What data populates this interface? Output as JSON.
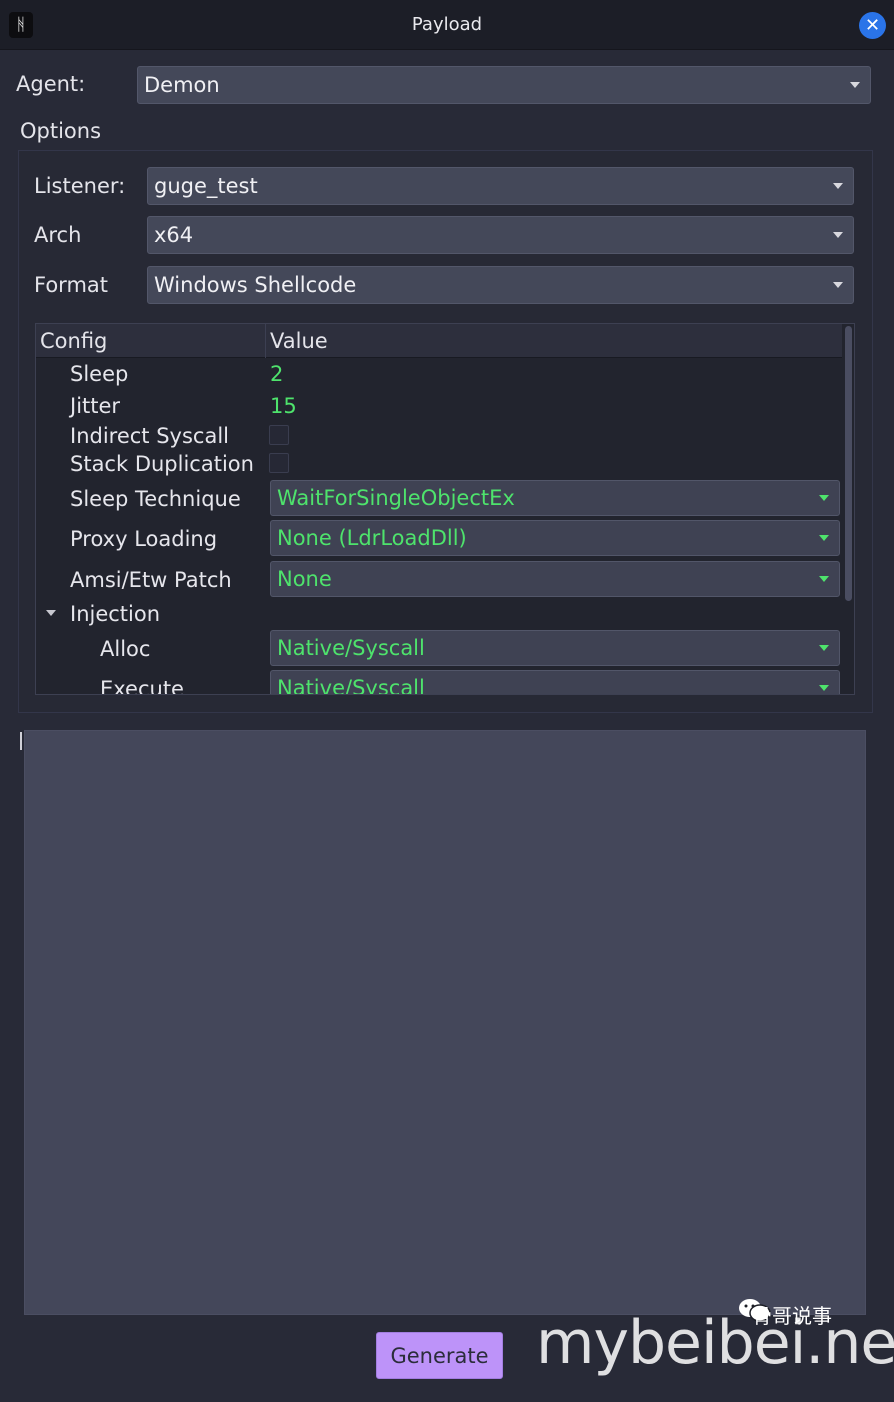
{
  "window": {
    "title": "Payload",
    "app_icon_glyph": "ᚻ",
    "close_glyph": "✕",
    "accent": "#2a74e8"
  },
  "agent": {
    "label": "Agent:",
    "value": "Demon"
  },
  "options": {
    "title": "Options",
    "listener": {
      "label": "Listener:",
      "value": "guge_test"
    },
    "arch": {
      "label": "Arch",
      "value": "x64"
    },
    "format": {
      "label": "Format",
      "value": "Windows Shellcode"
    }
  },
  "config_tree": {
    "headers": {
      "config": "Config",
      "value": "Value"
    },
    "rows": {
      "sleep": {
        "label": "Sleep",
        "value": "2"
      },
      "jitter": {
        "label": "Jitter",
        "value": "15"
      },
      "indirect_syscall": {
        "label": "Indirect Syscall",
        "checked": false
      },
      "stack_duplication": {
        "label": "Stack Duplication",
        "checked": false
      },
      "sleep_technique": {
        "label": "Sleep Technique",
        "value": "WaitForSingleObjectEx"
      },
      "proxy_loading": {
        "label": "Proxy Loading",
        "value": "None (LdrLoadDll)"
      },
      "amsi_etw_patch": {
        "label": "Amsi/Etw Patch",
        "value": "None"
      },
      "injection": {
        "label": "Injection",
        "expanded": true
      },
      "alloc": {
        "label": "Alloc",
        "value": "Native/Syscall"
      },
      "execute": {
        "label": "Execute",
        "value": "Native/Syscall"
      }
    },
    "value_color": "#4ee36c"
  },
  "output": {
    "text": ""
  },
  "generate_button": {
    "label": "Generate",
    "color": "#bd93f9"
  },
  "watermark": {
    "brand": "骨哥说事",
    "site": "mybeibei.net"
  }
}
